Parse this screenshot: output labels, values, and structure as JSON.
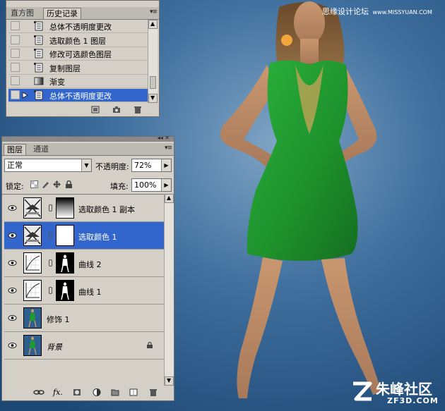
{
  "history_panel": {
    "tabs": [
      "直方图",
      "历史记录"
    ],
    "items": [
      {
        "label": "总体不透明度更改",
        "icon": "history-step-icon",
        "selected": false
      },
      {
        "label": "选取颜色 1 图层",
        "icon": "history-step-icon",
        "selected": false
      },
      {
        "label": "修改可选颜色图层",
        "icon": "history-step-icon",
        "selected": false
      },
      {
        "label": "复制图层",
        "icon": "history-step-icon",
        "selected": false
      },
      {
        "label": "渐变",
        "icon": "gradient-icon",
        "selected": false
      },
      {
        "label": "总体不透明度更改",
        "icon": "history-step-icon",
        "selected": true
      }
    ]
  },
  "layers_panel": {
    "tabs": [
      "图层",
      "通道"
    ],
    "blend_mode": "正常",
    "opacity_label": "不透明度:",
    "opacity_value": "72%",
    "lock_label": "锁定:",
    "fill_label": "填充:",
    "fill_value": "100%",
    "layers": [
      {
        "name": "选取颜色 1 副本",
        "type": "selective-color",
        "mask": "gradient",
        "selected": false
      },
      {
        "name": "选取颜色 1",
        "type": "selective-color",
        "mask": "white",
        "selected": true
      },
      {
        "name": "曲线 2",
        "type": "curves",
        "mask": "figure",
        "selected": false
      },
      {
        "name": "曲线 1",
        "type": "curves",
        "mask": "figure",
        "selected": false
      },
      {
        "name": "修饰 1",
        "type": "photo",
        "mask": null,
        "selected": false
      },
      {
        "name": "背景",
        "type": "photo",
        "mask": null,
        "selected": false,
        "locked": true
      }
    ]
  },
  "watermarks": {
    "top": "思缘设计论坛",
    "top_url": "www.MISSYUAN.COM",
    "bottom": "朱峰社区",
    "bottom_url": "ZF3D.COM"
  },
  "colors": {
    "panel_bg": "#d4d0c8",
    "selection": "#3366cc",
    "backdrop": "#2a5a88",
    "dress": "#1f9a2e"
  }
}
